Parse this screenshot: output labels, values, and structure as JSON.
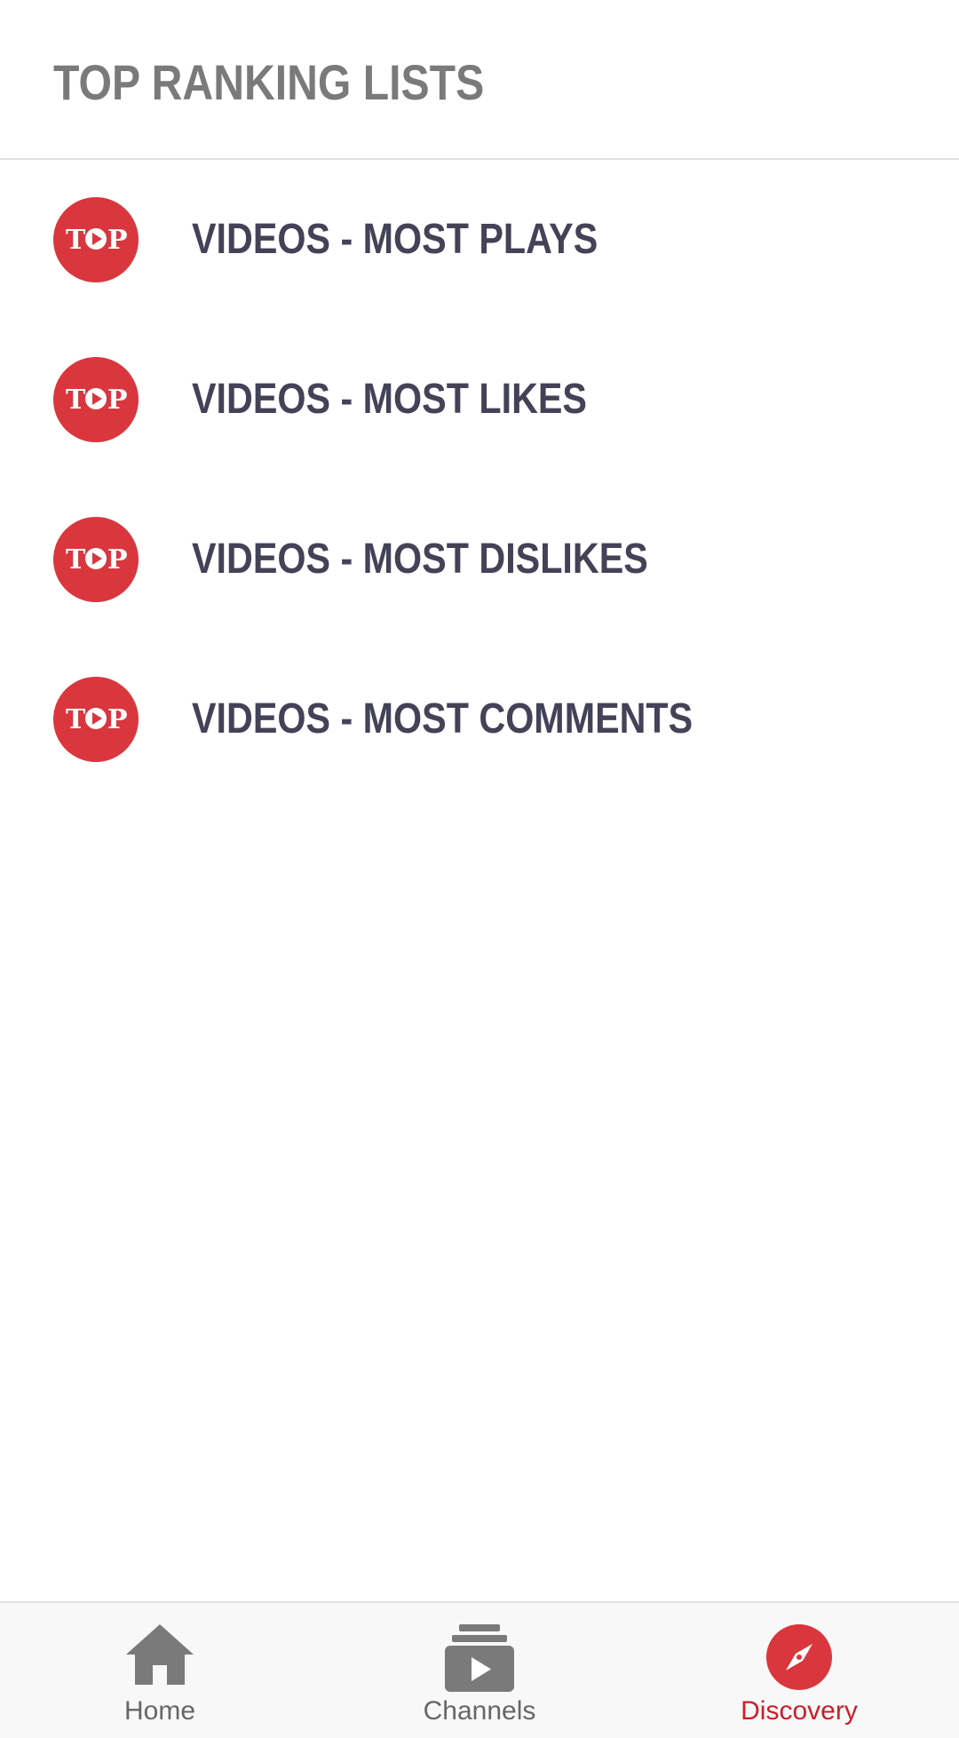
{
  "header": {
    "title": "TOP RANKING LISTS"
  },
  "list": {
    "items": [
      {
        "icon": "top-video-icon",
        "icon_text": "TOP",
        "label": "VIDEOS - MOST PLAYS"
      },
      {
        "icon": "top-video-icon",
        "icon_text": "TOP",
        "label": "VIDEOS - MOST LIKES"
      },
      {
        "icon": "top-video-icon",
        "icon_text": "TOP",
        "label": "VIDEOS - MOST DISLIKES"
      },
      {
        "icon": "top-video-icon",
        "icon_text": "TOP",
        "label": "VIDEOS - MOST COMMENTS"
      }
    ]
  },
  "bottom_nav": {
    "items": [
      {
        "icon": "home-icon",
        "label": "Home",
        "active": false
      },
      {
        "icon": "channels-icon",
        "label": "Channels",
        "active": false
      },
      {
        "icon": "compass-icon",
        "label": "Discovery",
        "active": true
      }
    ]
  },
  "colors": {
    "accent": "#d9373d",
    "active_label": "#c8202a",
    "title_gray": "#7a7a7a",
    "item_text": "#434257",
    "nav_icon_gray": "#7a7a7a"
  }
}
